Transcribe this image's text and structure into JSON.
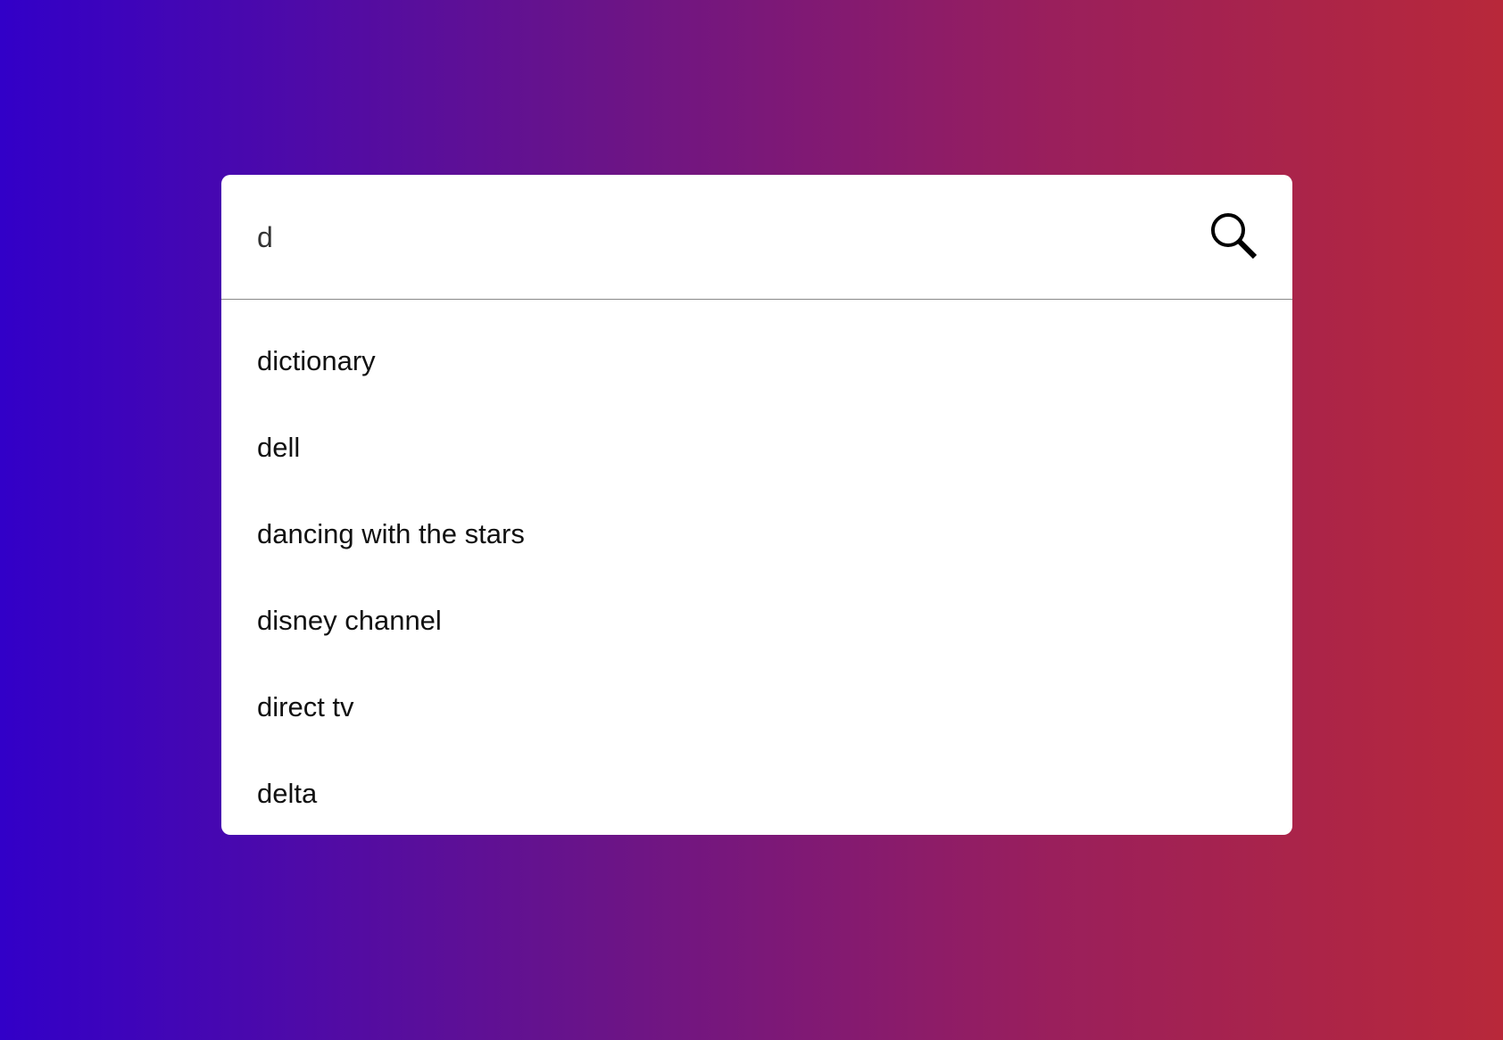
{
  "search": {
    "query": "d",
    "icon": "search-icon"
  },
  "suggestions": [
    {
      "label": "dictionary"
    },
    {
      "label": "dell"
    },
    {
      "label": "dancing with the stars"
    },
    {
      "label": "disney channel"
    },
    {
      "label": "direct tv"
    },
    {
      "label": "delta"
    }
  ],
  "colors": {
    "gradient_start": "#3200c8",
    "gradient_end": "#b8283a",
    "card": "#ffffff"
  }
}
